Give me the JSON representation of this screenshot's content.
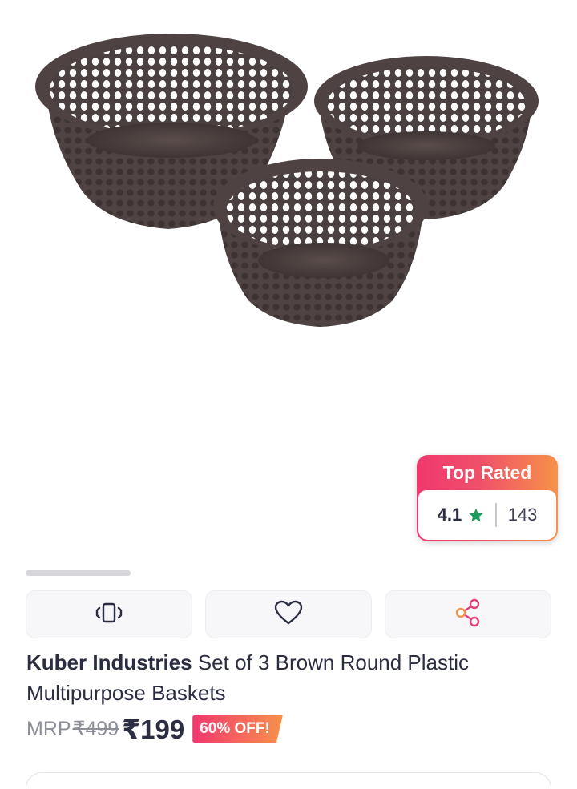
{
  "product": {
    "image_alt_icon": "basket-set-image",
    "brand": "Kuber Industries",
    "title": " Set of 3 Brown Round Plastic Multipurpose Baskets"
  },
  "rating_badge": {
    "label": "Top Rated",
    "rating": "4.1",
    "count": "143",
    "star_color": "#1d9b5a"
  },
  "gallery": {
    "progress": 0.2
  },
  "actions": [
    {
      "icon": "device-vibrate-icon"
    },
    {
      "icon": "heart-icon"
    },
    {
      "icon": "share-icon",
      "color": "#e0407a"
    }
  ],
  "pricing": {
    "mrp_label": "MRP",
    "mrp_value": "₹499",
    "price": "₹199",
    "discount": "60% OFF!"
  },
  "colors": {
    "accent_gradient_start": "#f0376f",
    "accent_gradient_end": "#f7924a",
    "text_primary": "#2b2d42",
    "text_muted": "#8b8d98"
  }
}
